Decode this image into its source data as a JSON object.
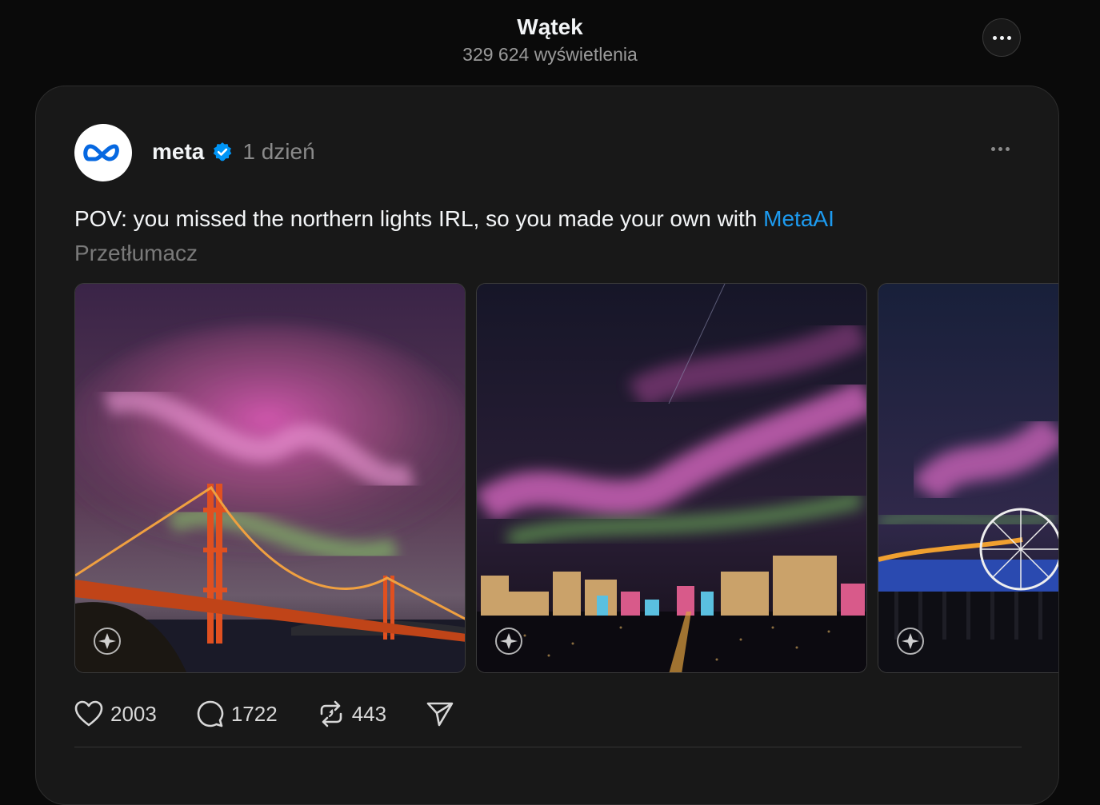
{
  "header": {
    "title": "Wątek",
    "views": "329 624 wyświetlenia",
    "more_icon": "more-horizontal-icon"
  },
  "post": {
    "author": "meta",
    "verified": true,
    "time": "1 dzień",
    "text": "POV: you missed the northern lights IRL, so you made your own with ",
    "link_text": "MetaAI",
    "translate_label": "Przetłumacz",
    "images": [
      {
        "subject": "Golden Gate Bridge under aurora"
      },
      {
        "subject": "City skyline under aurora"
      },
      {
        "subject": "Pier with ferris wheel under aurora"
      }
    ],
    "actions": {
      "likes": "2003",
      "comments": "1722",
      "reposts": "443"
    }
  },
  "colors": {
    "background": "#0a0a0a",
    "card": "#181818",
    "link": "#1d9bf0",
    "verified": "#0095f6",
    "meta_logo": "#0668e1"
  }
}
